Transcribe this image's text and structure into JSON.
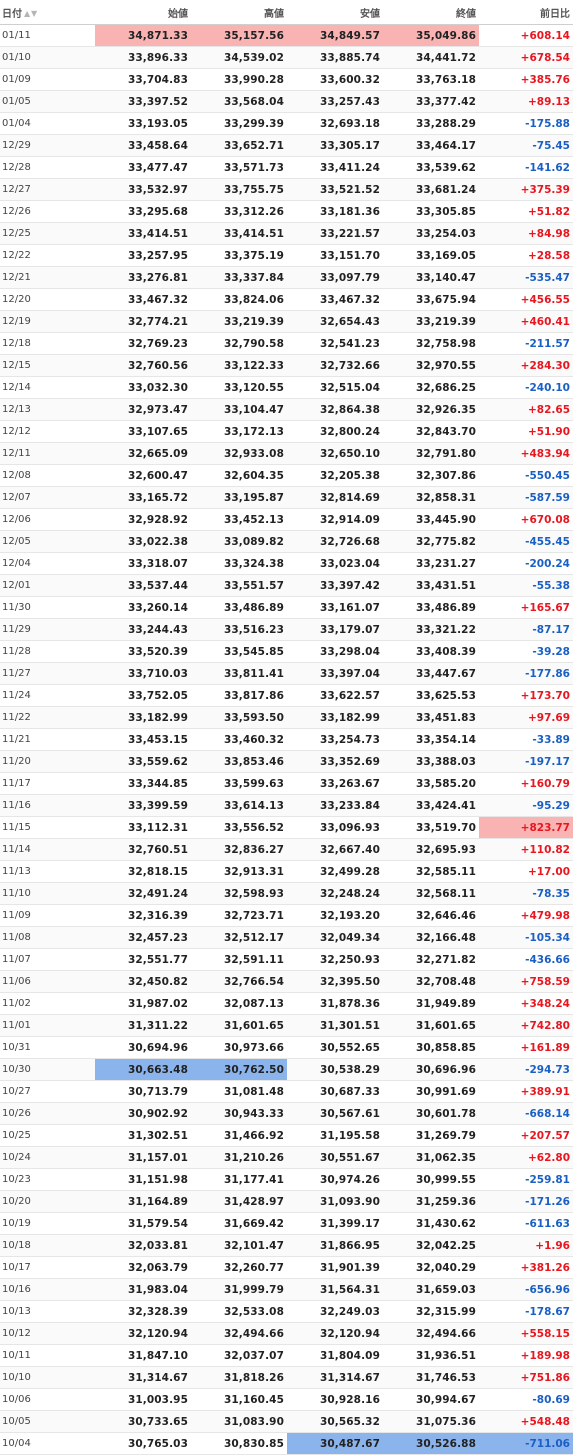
{
  "colors": {
    "up": "#e8161f",
    "down": "#1a5fc4",
    "highlight_high": "#f9b3b3",
    "highlight_low": "#8cb4ec"
  },
  "table": {
    "headers": {
      "date": "日付",
      "open": "始値",
      "high": "高値",
      "low": "安値",
      "close": "終値",
      "change": "前日比"
    },
    "sort_icons": [
      "sort-ascending-icon",
      "sort-descending-icon"
    ],
    "rows": [
      {
        "date": "01/11",
        "open": "34,871.33",
        "high": "35,157.56",
        "low": "34,849.57",
        "close": "35,049.86",
        "change": "+608.14",
        "hl": {
          "open": "high",
          "high": "high",
          "low": "high",
          "close": "high"
        }
      },
      {
        "date": "01/10",
        "open": "33,896.33",
        "high": "34,539.02",
        "low": "33,885.74",
        "close": "34,441.72",
        "change": "+678.54"
      },
      {
        "date": "01/09",
        "open": "33,704.83",
        "high": "33,990.28",
        "low": "33,600.32",
        "close": "33,763.18",
        "change": "+385.76"
      },
      {
        "date": "01/05",
        "open": "33,397.52",
        "high": "33,568.04",
        "low": "33,257.43",
        "close": "33,377.42",
        "change": "+89.13"
      },
      {
        "date": "01/04",
        "open": "33,193.05",
        "high": "33,299.39",
        "low": "32,693.18",
        "close": "33,288.29",
        "change": "-175.88"
      },
      {
        "date": "12/29",
        "open": "33,458.64",
        "high": "33,652.71",
        "low": "33,305.17",
        "close": "33,464.17",
        "change": "-75.45"
      },
      {
        "date": "12/28",
        "open": "33,477.47",
        "high": "33,571.73",
        "low": "33,411.24",
        "close": "33,539.62",
        "change": "-141.62"
      },
      {
        "date": "12/27",
        "open": "33,532.97",
        "high": "33,755.75",
        "low": "33,521.52",
        "close": "33,681.24",
        "change": "+375.39"
      },
      {
        "date": "12/26",
        "open": "33,295.68",
        "high": "33,312.26",
        "low": "33,181.36",
        "close": "33,305.85",
        "change": "+51.82"
      },
      {
        "date": "12/25",
        "open": "33,414.51",
        "high": "33,414.51",
        "low": "33,221.57",
        "close": "33,254.03",
        "change": "+84.98"
      },
      {
        "date": "12/22",
        "open": "33,257.95",
        "high": "33,375.19",
        "low": "33,151.70",
        "close": "33,169.05",
        "change": "+28.58"
      },
      {
        "date": "12/21",
        "open": "33,276.81",
        "high": "33,337.84",
        "low": "33,097.79",
        "close": "33,140.47",
        "change": "-535.47"
      },
      {
        "date": "12/20",
        "open": "33,467.32",
        "high": "33,824.06",
        "low": "33,467.32",
        "close": "33,675.94",
        "change": "+456.55"
      },
      {
        "date": "12/19",
        "open": "32,774.21",
        "high": "33,219.39",
        "low": "32,654.43",
        "close": "33,219.39",
        "change": "+460.41"
      },
      {
        "date": "12/18",
        "open": "32,769.23",
        "high": "32,790.58",
        "low": "32,541.23",
        "close": "32,758.98",
        "change": "-211.57"
      },
      {
        "date": "12/15",
        "open": "32,760.56",
        "high": "33,122.33",
        "low": "32,732.66",
        "close": "32,970.55",
        "change": "+284.30"
      },
      {
        "date": "12/14",
        "open": "33,032.30",
        "high": "33,120.55",
        "low": "32,515.04",
        "close": "32,686.25",
        "change": "-240.10"
      },
      {
        "date": "12/13",
        "open": "32,973.47",
        "high": "33,104.47",
        "low": "32,864.38",
        "close": "32,926.35",
        "change": "+82.65"
      },
      {
        "date": "12/12",
        "open": "33,107.65",
        "high": "33,172.13",
        "low": "32,800.24",
        "close": "32,843.70",
        "change": "+51.90"
      },
      {
        "date": "12/11",
        "open": "32,665.09",
        "high": "32,933.08",
        "low": "32,650.10",
        "close": "32,791.80",
        "change": "+483.94"
      },
      {
        "date": "12/08",
        "open": "32,600.47",
        "high": "32,604.35",
        "low": "32,205.38",
        "close": "32,307.86",
        "change": "-550.45"
      },
      {
        "date": "12/07",
        "open": "33,165.72",
        "high": "33,195.87",
        "low": "32,814.69",
        "close": "32,858.31",
        "change": "-587.59"
      },
      {
        "date": "12/06",
        "open": "32,928.92",
        "high": "33,452.13",
        "low": "32,914.09",
        "close": "33,445.90",
        "change": "+670.08"
      },
      {
        "date": "12/05",
        "open": "33,022.38",
        "high": "33,089.82",
        "low": "32,726.68",
        "close": "32,775.82",
        "change": "-455.45"
      },
      {
        "date": "12/04",
        "open": "33,318.07",
        "high": "33,324.38",
        "low": "33,023.04",
        "close": "33,231.27",
        "change": "-200.24"
      },
      {
        "date": "12/01",
        "open": "33,537.44",
        "high": "33,551.57",
        "low": "33,397.42",
        "close": "33,431.51",
        "change": "-55.38"
      },
      {
        "date": "11/30",
        "open": "33,260.14",
        "high": "33,486.89",
        "low": "33,161.07",
        "close": "33,486.89",
        "change": "+165.67"
      },
      {
        "date": "11/29",
        "open": "33,244.43",
        "high": "33,516.23",
        "low": "33,179.07",
        "close": "33,321.22",
        "change": "-87.17"
      },
      {
        "date": "11/28",
        "open": "33,520.39",
        "high": "33,545.85",
        "low": "33,298.04",
        "close": "33,408.39",
        "change": "-39.28"
      },
      {
        "date": "11/27",
        "open": "33,710.03",
        "high": "33,811.41",
        "low": "33,397.04",
        "close": "33,447.67",
        "change": "-177.86"
      },
      {
        "date": "11/24",
        "open": "33,752.05",
        "high": "33,817.86",
        "low": "33,622.57",
        "close": "33,625.53",
        "change": "+173.70"
      },
      {
        "date": "11/22",
        "open": "33,182.99",
        "high": "33,593.50",
        "low": "33,182.99",
        "close": "33,451.83",
        "change": "+97.69"
      },
      {
        "date": "11/21",
        "open": "33,453.15",
        "high": "33,460.32",
        "low": "33,254.73",
        "close": "33,354.14",
        "change": "-33.89"
      },
      {
        "date": "11/20",
        "open": "33,559.62",
        "high": "33,853.46",
        "low": "33,352.69",
        "close": "33,388.03",
        "change": "-197.17"
      },
      {
        "date": "11/17",
        "open": "33,344.85",
        "high": "33,599.63",
        "low": "33,263.67",
        "close": "33,585.20",
        "change": "+160.79"
      },
      {
        "date": "11/16",
        "open": "33,399.59",
        "high": "33,614.13",
        "low": "33,233.84",
        "close": "33,424.41",
        "change": "-95.29"
      },
      {
        "date": "11/15",
        "open": "33,112.31",
        "high": "33,556.52",
        "low": "33,096.93",
        "close": "33,519.70",
        "change": "+823.77",
        "hl": {
          "change": "high"
        }
      },
      {
        "date": "11/14",
        "open": "32,760.51",
        "high": "32,836.27",
        "low": "32,667.40",
        "close": "32,695.93",
        "change": "+110.82"
      },
      {
        "date": "11/13",
        "open": "32,818.15",
        "high": "32,913.31",
        "low": "32,499.28",
        "close": "32,585.11",
        "change": "+17.00"
      },
      {
        "date": "11/10",
        "open": "32,491.24",
        "high": "32,598.93",
        "low": "32,248.24",
        "close": "32,568.11",
        "change": "-78.35"
      },
      {
        "date": "11/09",
        "open": "32,316.39",
        "high": "32,723.71",
        "low": "32,193.20",
        "close": "32,646.46",
        "change": "+479.98"
      },
      {
        "date": "11/08",
        "open": "32,457.23",
        "high": "32,512.17",
        "low": "32,049.34",
        "close": "32,166.48",
        "change": "-105.34"
      },
      {
        "date": "11/07",
        "open": "32,551.77",
        "high": "32,591.11",
        "low": "32,250.93",
        "close": "32,271.82",
        "change": "-436.66"
      },
      {
        "date": "11/06",
        "open": "32,450.82",
        "high": "32,766.54",
        "low": "32,395.50",
        "close": "32,708.48",
        "change": "+758.59"
      },
      {
        "date": "11/02",
        "open": "31,987.02",
        "high": "32,087.13",
        "low": "31,878.36",
        "close": "31,949.89",
        "change": "+348.24"
      },
      {
        "date": "11/01",
        "open": "31,311.22",
        "high": "31,601.65",
        "low": "31,301.51",
        "close": "31,601.65",
        "change": "+742.80"
      },
      {
        "date": "10/31",
        "open": "30,694.96",
        "high": "30,973.66",
        "low": "30,552.65",
        "close": "30,858.85",
        "change": "+161.89"
      },
      {
        "date": "10/30",
        "open": "30,663.48",
        "high": "30,762.50",
        "low": "30,538.29",
        "close": "30,696.96",
        "change": "-294.73",
        "hl": {
          "open": "low",
          "high": "low"
        }
      },
      {
        "date": "10/27",
        "open": "30,713.79",
        "high": "31,081.48",
        "low": "30,687.33",
        "close": "30,991.69",
        "change": "+389.91"
      },
      {
        "date": "10/26",
        "open": "30,902.92",
        "high": "30,943.33",
        "low": "30,567.61",
        "close": "30,601.78",
        "change": "-668.14"
      },
      {
        "date": "10/25",
        "open": "31,302.51",
        "high": "31,466.92",
        "low": "31,195.58",
        "close": "31,269.79",
        "change": "+207.57"
      },
      {
        "date": "10/24",
        "open": "31,157.01",
        "high": "31,210.26",
        "low": "30,551.67",
        "close": "31,062.35",
        "change": "+62.80"
      },
      {
        "date": "10/23",
        "open": "31,151.98",
        "high": "31,177.41",
        "low": "30,974.26",
        "close": "30,999.55",
        "change": "-259.81"
      },
      {
        "date": "10/20",
        "open": "31,164.89",
        "high": "31,428.97",
        "low": "31,093.90",
        "close": "31,259.36",
        "change": "-171.26"
      },
      {
        "date": "10/19",
        "open": "31,579.54",
        "high": "31,669.42",
        "low": "31,399.17",
        "close": "31,430.62",
        "change": "-611.63"
      },
      {
        "date": "10/18",
        "open": "32,033.81",
        "high": "32,101.47",
        "low": "31,866.95",
        "close": "32,042.25",
        "change": "+1.96"
      },
      {
        "date": "10/17",
        "open": "32,063.79",
        "high": "32,260.77",
        "low": "31,901.39",
        "close": "32,040.29",
        "change": "+381.26"
      },
      {
        "date": "10/16",
        "open": "31,983.04",
        "high": "31,999.79",
        "low": "31,564.31",
        "close": "31,659.03",
        "change": "-656.96"
      },
      {
        "date": "10/13",
        "open": "32,328.39",
        "high": "32,533.08",
        "low": "32,249.03",
        "close": "32,315.99",
        "change": "-178.67"
      },
      {
        "date": "10/12",
        "open": "32,120.94",
        "high": "32,494.66",
        "low": "32,120.94",
        "close": "32,494.66",
        "change": "+558.15"
      },
      {
        "date": "10/11",
        "open": "31,847.10",
        "high": "32,037.07",
        "low": "31,804.09",
        "close": "31,936.51",
        "change": "+189.98"
      },
      {
        "date": "10/10",
        "open": "31,314.67",
        "high": "31,818.26",
        "low": "31,314.67",
        "close": "31,746.53",
        "change": "+751.86"
      },
      {
        "date": "10/06",
        "open": "31,003.95",
        "high": "31,160.45",
        "low": "30,928.16",
        "close": "30,994.67",
        "change": "-80.69"
      },
      {
        "date": "10/05",
        "open": "30,733.65",
        "high": "31,083.90",
        "low": "30,565.32",
        "close": "31,075.36",
        "change": "+548.48"
      },
      {
        "date": "10/04",
        "open": "30,765.03",
        "high": "30,830.85",
        "low": "30,487.67",
        "close": "30,526.88",
        "change": "-711.06",
        "hl": {
          "low": "low",
          "close": "low",
          "change": "low"
        }
      }
    ]
  }
}
